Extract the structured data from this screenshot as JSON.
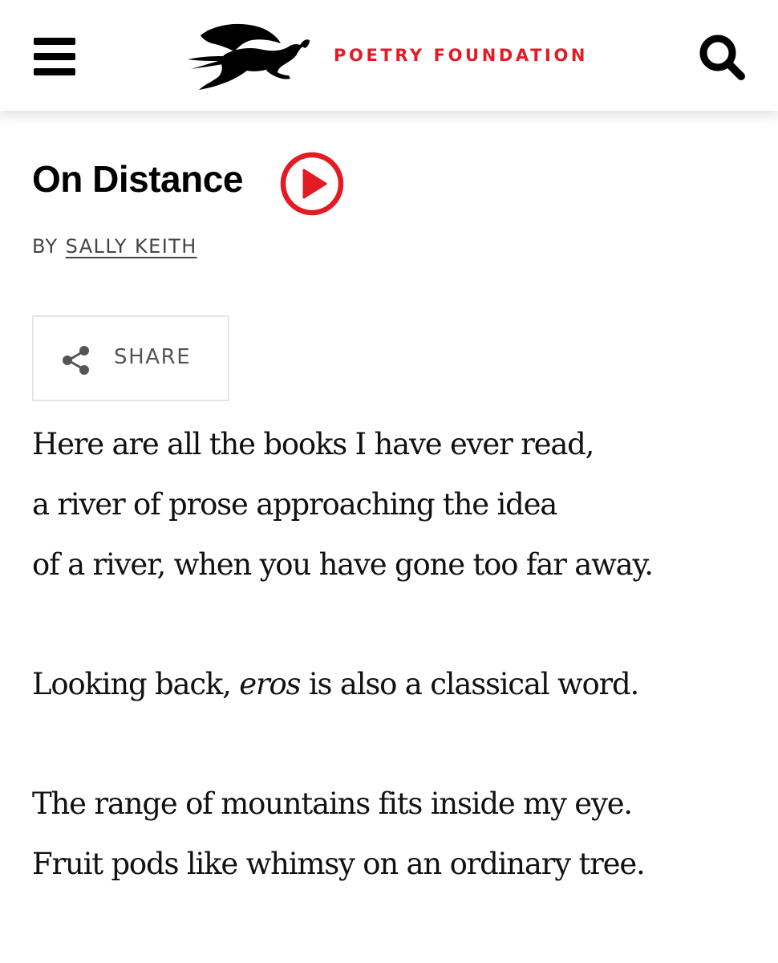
{
  "header": {
    "menu_icon": "hamburger-menu-icon",
    "logo_icon": "pegasus-icon",
    "brand": "POETRY FOUNDATION",
    "search_icon": "search-icon",
    "brand_color": "#e31b23"
  },
  "poem": {
    "title": "On Distance",
    "play_icon": "play-circle-icon",
    "by_prefix": "BY",
    "author": "SALLY KEITH",
    "share_label": "SHARE",
    "share_icon": "share-icon",
    "stanza1": {
      "line1": "Here are all the books I have ever read,",
      "line2": "a river of prose approaching the idea",
      "line3": "of a river, when you have gone too far away."
    },
    "stanza2": {
      "line1_before": "Looking back, ",
      "line1_italic": "eros",
      "line1_after": " is also a classical word."
    },
    "stanza3": {
      "line1": "The range of mountains fits inside my eye.",
      "line2": "Fruit pods like whimsy on an ordinary tree."
    }
  }
}
